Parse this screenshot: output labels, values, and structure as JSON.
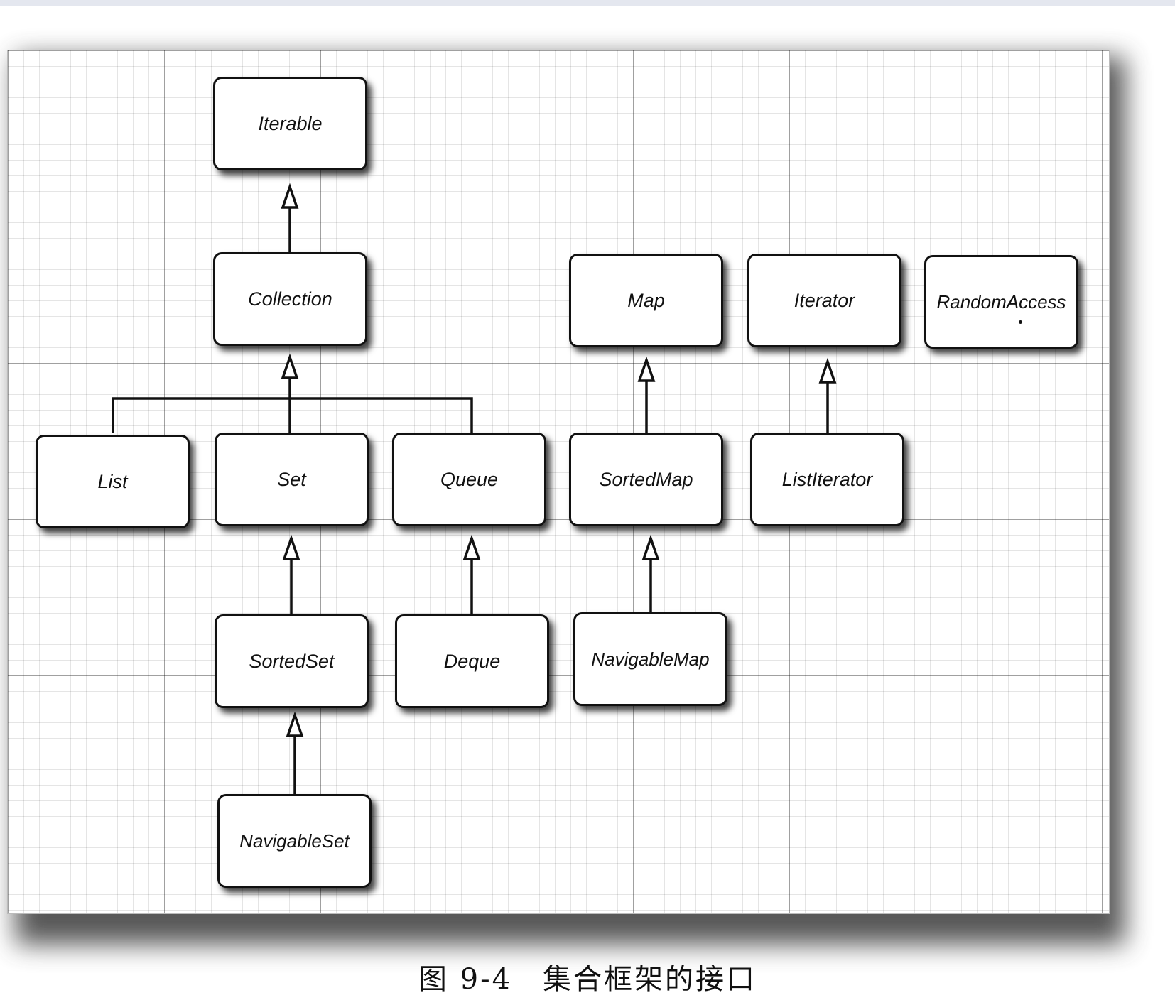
{
  "diagram": {
    "nodes": {
      "iterable": "Iterable",
      "collection": "Collection",
      "map": "Map",
      "iterator": "Iterator",
      "random_access": "RandomAccess",
      "list": "List",
      "set": "Set",
      "queue": "Queue",
      "sorted_map": "SortedMap",
      "list_iterator": "ListIterator",
      "sorted_set": "SortedSet",
      "deque": "Deque",
      "navigable_map": "NavigableMap",
      "navigable_set": "NavigableSet"
    },
    "edges": [
      {
        "from": "collection",
        "to": "iterable"
      },
      {
        "from": "list",
        "to": "collection"
      },
      {
        "from": "set",
        "to": "collection"
      },
      {
        "from": "queue",
        "to": "collection"
      },
      {
        "from": "sorted_map",
        "to": "map"
      },
      {
        "from": "list_iterator",
        "to": "iterator"
      },
      {
        "from": "sorted_set",
        "to": "set"
      },
      {
        "from": "deque",
        "to": "queue"
      },
      {
        "from": "navigable_map",
        "to": "sorted_map"
      },
      {
        "from": "navigable_set",
        "to": "sorted_set"
      }
    ]
  },
  "caption": "图 9-4　集合框架的接口"
}
